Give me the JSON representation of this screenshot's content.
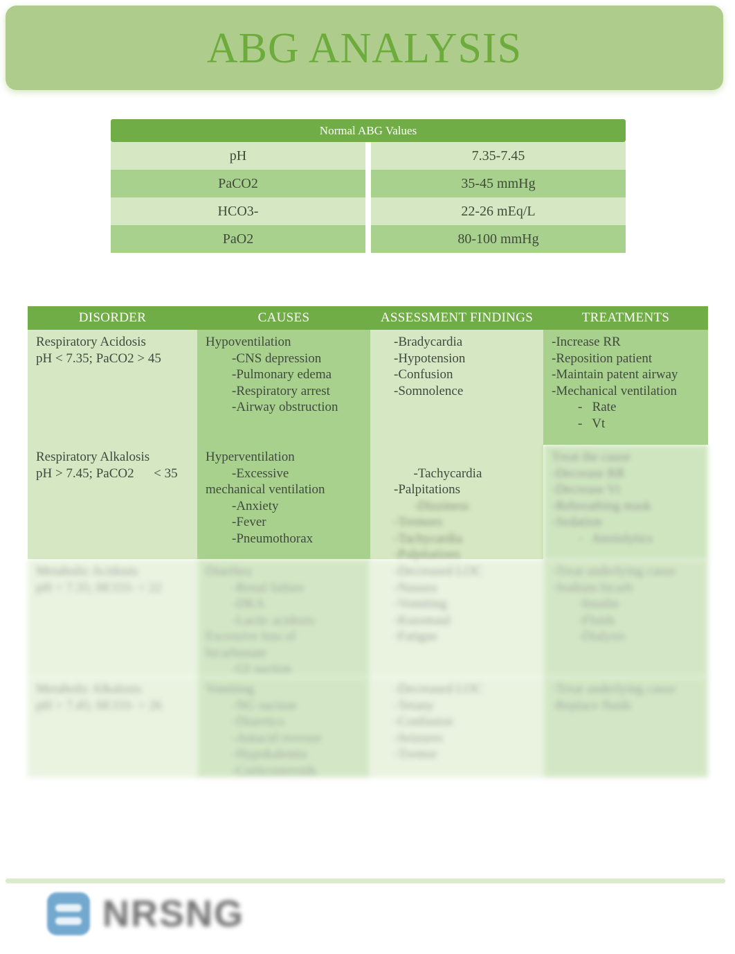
{
  "document": {
    "title": "ABG ANALYSIS",
    "accent_color": "#70ad47",
    "banner_color": "#aecd8c",
    "title_color": "#6cab3c",
    "row_tint_light": "#d6e7c3",
    "row_tint_dark": "#a9d18e"
  },
  "abg_values": {
    "header": "Normal ABG Values",
    "rows": [
      {
        "label": "pH",
        "value": "7.35-7.45"
      },
      {
        "label": "PaCO2",
        "value": "35-45 mmHg"
      },
      {
        "label": "HCO3-",
        "value": "22-26 mEq/L"
      },
      {
        "label": "PaO2",
        "value": "80-100 mmHg"
      }
    ]
  },
  "disorder_table": {
    "columns": [
      "DISORDER",
      "CAUSES",
      "ASSESSMENT FINDINGS",
      "TREATMENTS"
    ],
    "rows": [
      {
        "legible": true,
        "disorder": "Respiratory Acidosis\npH < 7.35; PaCO2 > 45",
        "causes": "Hypoventilation\n        -CNS depression\n        -Pulmonary edema\n        -Respiratory arrest\n        -Airway obstruction",
        "findings": "-Bradycardia\n-Hypotension\n-Confusion\n-Somnolence",
        "treatments": "-Increase RR\n-Reposition patient\n-Maintain patent airway\n-Mechanical ventilation\n        -   Rate\n        -   Vt"
      },
      {
        "legible": "partial",
        "disorder": "Respiratory Alkalosis\npH > 7.45; PaCO2      < 35",
        "causes": "Hyperventilation\n        -Excessive\nmechanical ventilation\n        -Anxiety\n        -Fever\n        -Pneumothorax",
        "findings": "-Tachycardia\n-Palpitations",
        "findings_blurred": "-Dizziness\n-Tremors\n-Tachycardia\n-Palpitations",
        "treatments_blurred": "Treat the cause\n-Decrease RR\n-Decrease Vt\n-Rebreathing mask\n-Sedation\n        -   Anxiolytics"
      },
      {
        "legible": false,
        "disorder_blurred": "Metabolic Acidosis\npH < 7.35; HCO3- < 22",
        "causes_blurred": "Diarrhea\n        -Renal failure\n        -DKA\n        -Lactic acidosis\nExcessive loss of\nbicarbonate\n        -GI suction",
        "findings_blurred": "-Decreased LOC\n-Nausea\n-Vomiting\n-Kussmaul\n-Fatigue",
        "treatments_blurred": "-Treat underlying cause\n-Sodium bicarb\n        -Insulin\n        -Fluids\n        -Dialysis"
      },
      {
        "legible": false,
        "disorder_blurred": "Metabolic Alkalosis\npH > 7.45; HCO3- > 26",
        "causes_blurred": "Vomiting\n        -NG suction\n        -Diuretics\n        -Antacid overuse\n        -Hypokalemia\n        -Corticosteroids",
        "findings_blurred": "-Decreased LOC\n-Tetany\n-Confusion\n-Seizures\n-Tremor",
        "treatments_blurred": "-Treat underlying cause\n-Replace fluids"
      }
    ]
  },
  "footer": {
    "logo_icon": "nrsng-logo-icon",
    "logo_color": "#74a9cf",
    "brand": "NRSNG"
  }
}
